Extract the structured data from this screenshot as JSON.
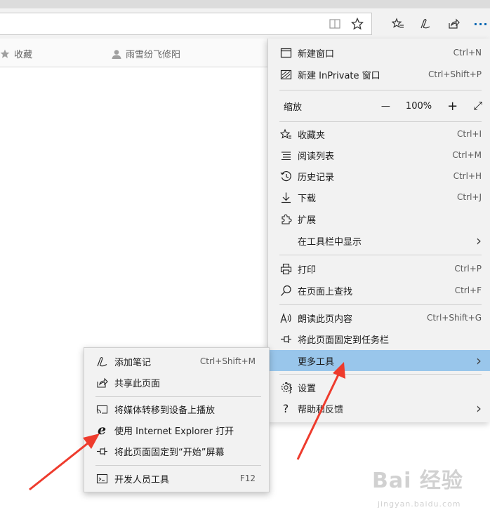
{
  "favorites_bar": {
    "favorites_label": "收藏",
    "user_label": "雨雪纷飞修阳"
  },
  "toolbar": {
    "more_label": "···"
  },
  "main_menu": {
    "new_window": {
      "label": "新建窗口",
      "shortcut": "Ctrl+N"
    },
    "new_inprivate": {
      "label": "新建 InPrivate 窗口",
      "shortcut": "Ctrl+Shift+P"
    },
    "zoom": {
      "label": "缩放",
      "minus": "—",
      "value": "100%",
      "plus": "+",
      "fullscreen": "⤢"
    },
    "favorites": {
      "label": "收藏夹",
      "shortcut": "Ctrl+I"
    },
    "reading_list": {
      "label": "阅读列表",
      "shortcut": "Ctrl+M"
    },
    "history": {
      "label": "历史记录",
      "shortcut": "Ctrl+H"
    },
    "downloads": {
      "label": "下载",
      "shortcut": "Ctrl+J"
    },
    "extensions": {
      "label": "扩展"
    },
    "show_in_toolbar": {
      "label": "在工具栏中显示",
      "arrow": "›"
    },
    "print": {
      "label": "打印",
      "shortcut": "Ctrl+P"
    },
    "find_on_page": {
      "label": "在页面上查找",
      "shortcut": "Ctrl+F"
    },
    "read_aloud": {
      "label": "朗读此页内容",
      "shortcut": "Ctrl+Shift+G"
    },
    "pin_taskbar": {
      "label": "将此页面固定到任务栏"
    },
    "more_tools": {
      "label": "更多工具",
      "arrow": "›"
    },
    "settings": {
      "label": "设置"
    },
    "help_feedback": {
      "label": "帮助和反馈",
      "arrow": "›"
    }
  },
  "sub_menu": {
    "add_notes": {
      "label": "添加笔记",
      "shortcut": "Ctrl+Shift+M"
    },
    "share_page": {
      "label": "共享此页面"
    },
    "cast_media": {
      "label": "将媒体转移到设备上播放"
    },
    "open_ie": {
      "label": "使用 Internet Explorer 打开"
    },
    "pin_start": {
      "label": "将此页面固定到“开始”屏幕"
    },
    "dev_tools": {
      "label": "开发人员工具",
      "shortcut": "F12"
    }
  },
  "watermark": {
    "main": "Bai 经验",
    "sub": "jingyan.baidu.com"
  },
  "colors": {
    "highlight": "#99c6eb",
    "arrow_red": "#ee3b2d",
    "accent": "#0063b1"
  }
}
